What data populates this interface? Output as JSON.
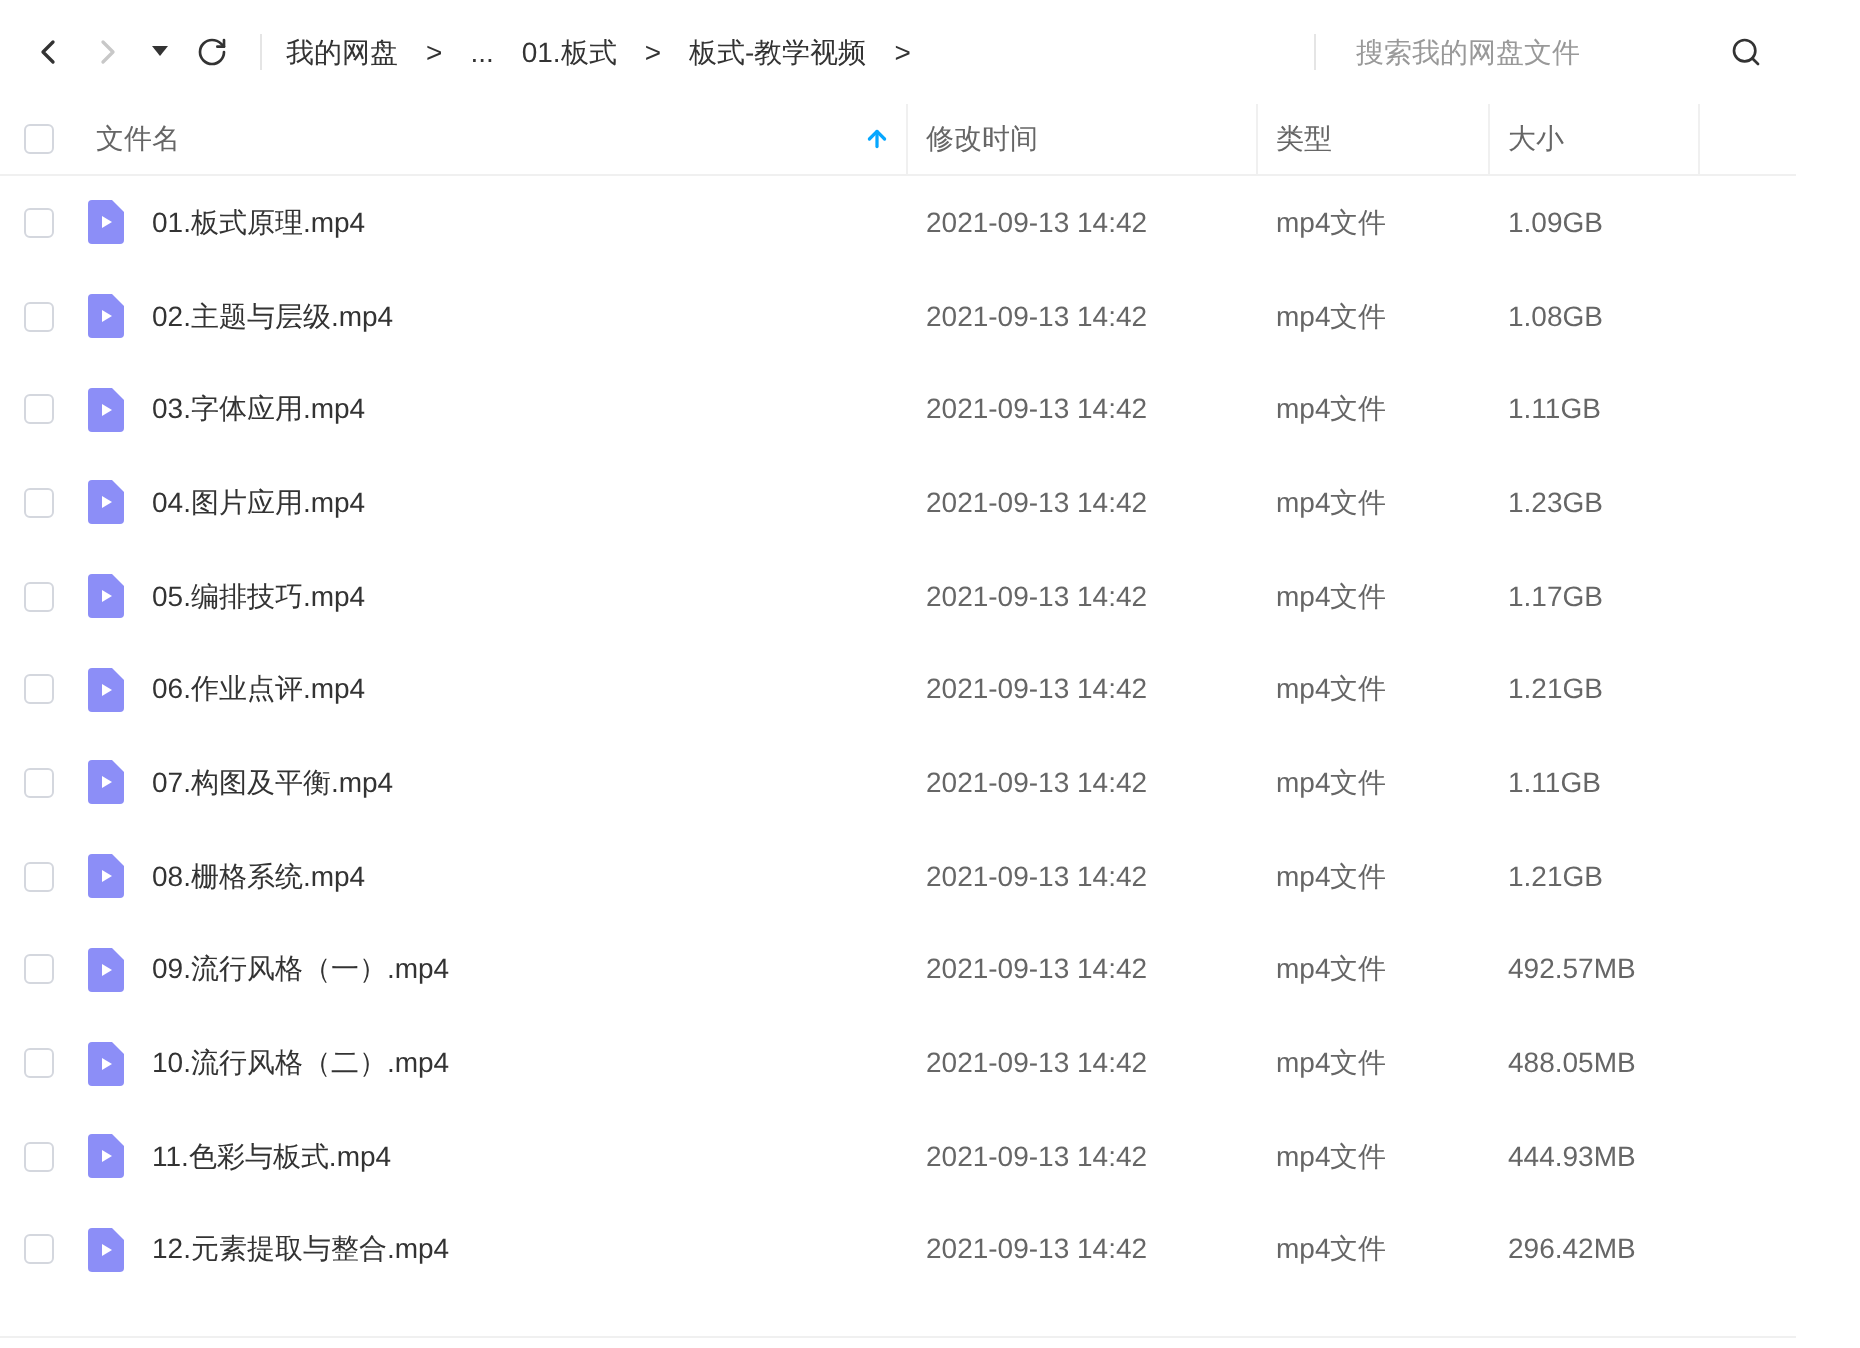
{
  "toolbar": {
    "nav": [
      {
        "kind": "back",
        "disabled": false
      },
      {
        "kind": "forward",
        "disabled": true
      },
      {
        "kind": "dropdown",
        "disabled": false
      },
      {
        "kind": "refresh",
        "disabled": false
      }
    ],
    "breadcrumb": [
      {
        "text": "我的网盘",
        "separator": ">"
      },
      {
        "text": "..."
      },
      {
        "text": "01.板式",
        "separator": ">"
      },
      {
        "text": "板式-教学视频",
        "separator": ">"
      }
    ],
    "search": {
      "placeholder": "搜索我的网盘文件"
    }
  },
  "table": {
    "select_all": {
      "checked": false
    },
    "columns": [
      {
        "label": "文件名",
        "sorted": true
      },
      {
        "label": "修改时间",
        "sorted": false
      },
      {
        "label": "类型",
        "sorted": false
      },
      {
        "label": "大小",
        "sorted": false
      }
    ],
    "rows": [
      {
        "checked": false,
        "name": "01.板式原理.mp4",
        "modified": "2021-09-13 14:42",
        "type": "mp4文件",
        "size": "1.09GB"
      },
      {
        "checked": false,
        "name": "02.主题与层级.mp4",
        "modified": "2021-09-13 14:42",
        "type": "mp4文件",
        "size": "1.08GB"
      },
      {
        "checked": false,
        "name": "03.字体应用.mp4",
        "modified": "2021-09-13 14:42",
        "type": "mp4文件",
        "size": "1.11GB"
      },
      {
        "checked": false,
        "name": "04.图片应用.mp4",
        "modified": "2021-09-13 14:42",
        "type": "mp4文件",
        "size": "1.23GB"
      },
      {
        "checked": false,
        "name": "05.编排技巧.mp4",
        "modified": "2021-09-13 14:42",
        "type": "mp4文件",
        "size": "1.17GB"
      },
      {
        "checked": false,
        "name": "06.作业点评.mp4",
        "modified": "2021-09-13 14:42",
        "type": "mp4文件",
        "size": "1.21GB"
      },
      {
        "checked": false,
        "name": "07.构图及平衡.mp4",
        "modified": "2021-09-13 14:42",
        "type": "mp4文件",
        "size": "1.11GB"
      },
      {
        "checked": false,
        "name": "08.栅格系统.mp4",
        "modified": "2021-09-13 14:42",
        "type": "mp4文件",
        "size": "1.21GB"
      },
      {
        "checked": false,
        "name": "09.流行风格（一）.mp4",
        "modified": "2021-09-13 14:42",
        "type": "mp4文件",
        "size": "492.57MB"
      },
      {
        "checked": false,
        "name": "10.流行风格（二）.mp4",
        "modified": "2021-09-13 14:42",
        "type": "mp4文件",
        "size": "488.05MB"
      },
      {
        "checked": false,
        "name": "11.色彩与板式.mp4",
        "modified": "2021-09-13 14:42",
        "type": "mp4文件",
        "size": "444.93MB"
      },
      {
        "checked": false,
        "name": "12.元素提取与整合.mp4",
        "modified": "2021-09-13 14:42",
        "type": "mp4文件",
        "size": "296.42MB"
      }
    ]
  }
}
